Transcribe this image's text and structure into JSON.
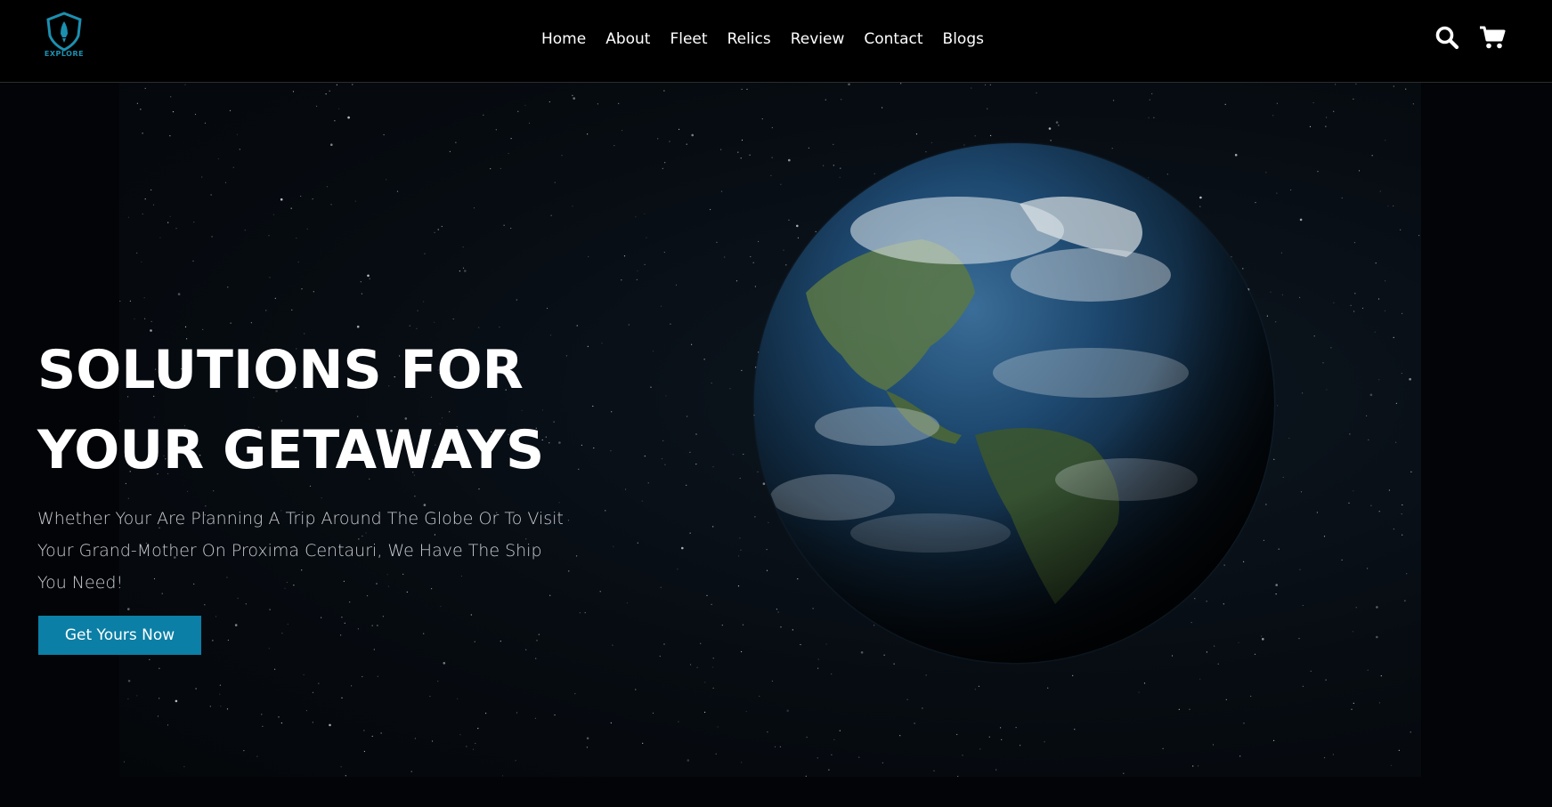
{
  "header": {
    "logo_text": "EXPLORE",
    "nav": [
      {
        "label": "Home"
      },
      {
        "label": "About"
      },
      {
        "label": "Fleet"
      },
      {
        "label": "Relics"
      },
      {
        "label": "Review"
      },
      {
        "label": "Contact"
      },
      {
        "label": "Blogs"
      }
    ],
    "icons": [
      "search-icon",
      "cart-icon"
    ]
  },
  "hero": {
    "title_line1": "SOLUTIONS FOR",
    "title_line2": "YOUR GETAWAYS",
    "subtitle": "Whether Your Are Planning A Trip Around The Globe Or To Visit Your Grand-Mother On Proxima Centauri, We Have The Ship You Need!",
    "cta_label": "Get Yours Now",
    "image": "earth-from-space"
  },
  "colors": {
    "accent": "#0b7fa6",
    "header_bg": "#000000",
    "text": "#ffffff",
    "logo": "#1c90b0"
  }
}
